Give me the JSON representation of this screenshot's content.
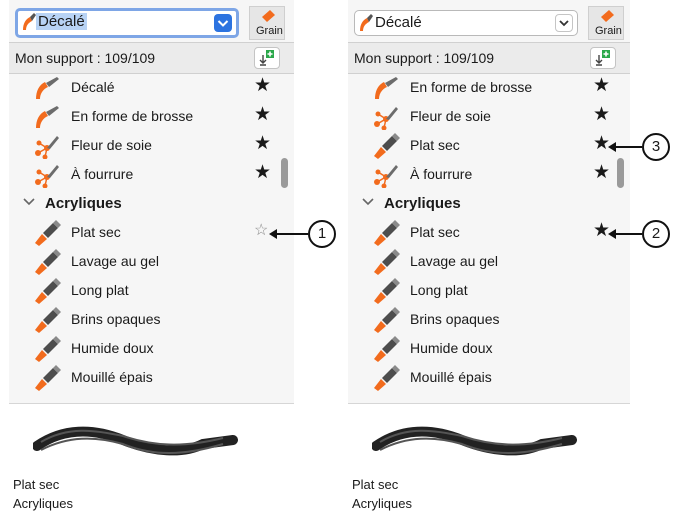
{
  "panels": [
    {
      "variant": "before",
      "brush_selector": {
        "value": "Décalé"
      },
      "grain_label": "Grain",
      "library_label": "Mon support : 109/109",
      "rows": [
        {
          "kind": "brush",
          "label": "Décalé",
          "icon": "orange-brush-icon",
          "favorite": true
        },
        {
          "kind": "brush",
          "label": "En forme de brosse",
          "icon": "orange-brush-icon",
          "favorite": true
        },
        {
          "kind": "brush",
          "label": "Fleur de soie",
          "icon": "fiber-brush-icon",
          "favorite": true
        },
        {
          "kind": "brush",
          "label": "À fourrure",
          "icon": "fiber-brush-icon",
          "favorite": true
        },
        {
          "kind": "category",
          "label": "Acryliques"
        },
        {
          "kind": "brush",
          "label": "Plat sec",
          "icon": "acrylic-brush-icon",
          "favorite": false
        },
        {
          "kind": "brush",
          "label": "Lavage au gel",
          "icon": "acrylic-brush-icon",
          "favorite": null
        },
        {
          "kind": "brush",
          "label": "Long plat",
          "icon": "acrylic-brush-icon",
          "favorite": null
        },
        {
          "kind": "brush",
          "label": "Brins opaques",
          "icon": "acrylic-brush-icon",
          "favorite": null
        },
        {
          "kind": "brush",
          "label": "Humide doux",
          "icon": "acrylic-brush-icon",
          "favorite": null
        },
        {
          "kind": "brush",
          "label": "Mouillé épais",
          "icon": "acrylic-brush-icon",
          "favorite": null
        }
      ],
      "footer": {
        "brush_name": "Plat sec",
        "category": "Acryliques"
      }
    },
    {
      "variant": "after",
      "brush_selector": {
        "value": "Décalé"
      },
      "grain_label": "Grain",
      "library_label": "Mon support : 109/109",
      "rows": [
        {
          "kind": "brush",
          "label": "En forme de brosse",
          "icon": "orange-brush-icon",
          "favorite": true
        },
        {
          "kind": "brush",
          "label": "Fleur de soie",
          "icon": "fiber-brush-icon",
          "favorite": true
        },
        {
          "kind": "brush",
          "label": "Plat sec",
          "icon": "acrylic-brush-icon",
          "favorite": true
        },
        {
          "kind": "brush",
          "label": "À fourrure",
          "icon": "fiber-brush-icon",
          "favorite": true
        },
        {
          "kind": "category",
          "label": "Acryliques"
        },
        {
          "kind": "brush",
          "label": "Plat sec",
          "icon": "acrylic-brush-icon",
          "favorite": true
        },
        {
          "kind": "brush",
          "label": "Lavage au gel",
          "icon": "acrylic-brush-icon",
          "favorite": null
        },
        {
          "kind": "brush",
          "label": "Long plat",
          "icon": "acrylic-brush-icon",
          "favorite": null
        },
        {
          "kind": "brush",
          "label": "Brins opaques",
          "icon": "acrylic-brush-icon",
          "favorite": null
        },
        {
          "kind": "brush",
          "label": "Humide doux",
          "icon": "acrylic-brush-icon",
          "favorite": null
        },
        {
          "kind": "brush",
          "label": "Mouillé épais",
          "icon": "acrylic-brush-icon",
          "favorite": null
        }
      ],
      "footer": {
        "brush_name": "Plat sec",
        "category": "Acryliques"
      }
    }
  ],
  "callouts": [
    {
      "number": "1",
      "panel": "before",
      "row": 5
    },
    {
      "number": "3",
      "panel": "after",
      "row": 2
    },
    {
      "number": "2",
      "panel": "after",
      "row": 5
    }
  ],
  "colors": {
    "accent": "#2c73e0",
    "selection": "#b8d3f5",
    "brush_orange": "#f26b1d",
    "star": "#111111"
  }
}
